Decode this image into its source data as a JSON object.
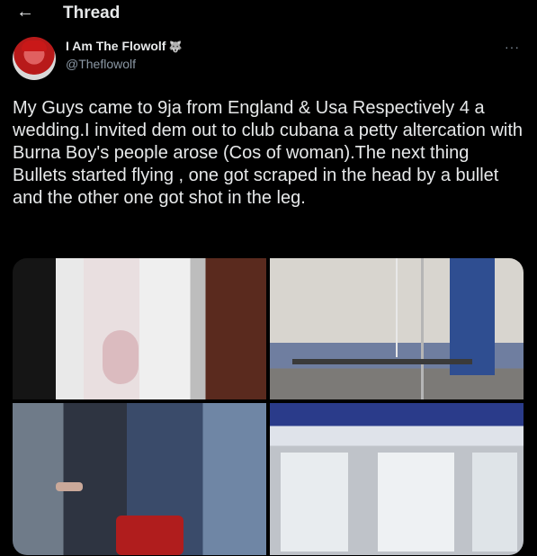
{
  "header": {
    "back_icon": "arrow-left-icon",
    "title": "Thread"
  },
  "tweet": {
    "author_name": "I Am The Flowolf",
    "author_badge": "🐺",
    "author_handle": "@Theflowolf",
    "more_label": "···",
    "text": "My Guys came to 9ja from England & Usa Respectively 4 a wedding.I invited dem out to club cubana a petty altercation with Burna Boy's people arose (Cos of woman).The next thing Bullets started flying , one got scraped in the head by a bullet and the other one got shot in the leg."
  },
  "colors": {
    "background": "#000000",
    "text": "#e7e9ea",
    "secondary_text": "#8b98a5"
  }
}
